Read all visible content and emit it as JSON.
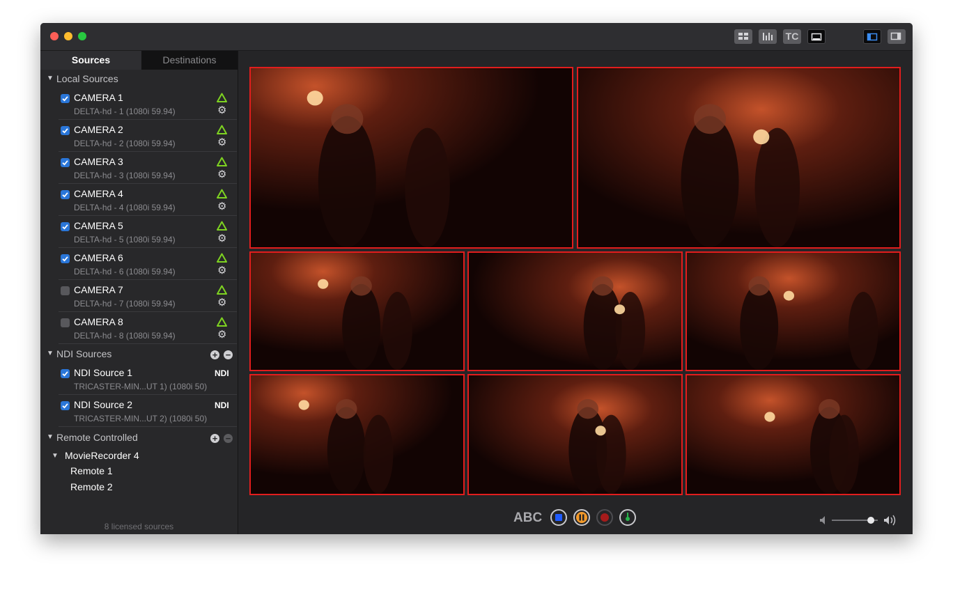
{
  "sidebar": {
    "tabs": [
      "Sources",
      "Destinations"
    ],
    "local_sources_label": "Local Sources",
    "cameras": [
      {
        "name": "CAMERA 1",
        "detail": "DELTA-hd - 1 (1080i 59.94)",
        "checked": true
      },
      {
        "name": "CAMERA 2",
        "detail": "DELTA-hd - 2 (1080i 59.94)",
        "checked": true
      },
      {
        "name": "CAMERA 3",
        "detail": "DELTA-hd - 3 (1080i 59.94)",
        "checked": true
      },
      {
        "name": "CAMERA 4",
        "detail": "DELTA-hd - 4 (1080i 59.94)",
        "checked": true
      },
      {
        "name": "CAMERA 5",
        "detail": "DELTA-hd - 5 (1080i 59.94)",
        "checked": true
      },
      {
        "name": "CAMERA 6",
        "detail": "DELTA-hd - 6 (1080i 59.94)",
        "checked": true
      },
      {
        "name": "CAMERA 7",
        "detail": "DELTA-hd - 7 (1080i 59.94)",
        "checked": false
      },
      {
        "name": "CAMERA 8",
        "detail": "DELTA-hd - 8 (1080i 59.94)",
        "checked": false
      }
    ],
    "ndi_sources_label": "NDI Sources",
    "ndi_sources": [
      {
        "name": "NDI Source 1",
        "detail": "TRICASTER-MIN...UT 1) (1080i 50)",
        "badge": "NDI",
        "checked": true
      },
      {
        "name": "NDI Source 2",
        "detail": "TRICASTER-MIN...UT 2) (1080i 50)",
        "badge": "NDI",
        "checked": true
      }
    ],
    "remote_label": "Remote Controlled",
    "remote_group": "MovieRecorder 4",
    "remote_items": [
      "Remote 1",
      "Remote 2"
    ],
    "footer": "8 licensed sources"
  },
  "toolbar": {
    "buttons": [
      "grid-layout-icon",
      "audio-meters-icon",
      "timecode",
      "monitor-icon"
    ],
    "timecode_label": "TC",
    "panel_buttons": [
      "left-panel-icon",
      "right-panel-icon"
    ]
  },
  "controls": {
    "abc_label": "ABC",
    "buttons": [
      "stop-icon",
      "pause-icon",
      "record-icon",
      "timer-icon"
    ],
    "volume_level": 0.85
  },
  "colors": {
    "tile_border": "#e21d1d",
    "checkbox": "#2a76d8",
    "warning": "#7ed321",
    "stop": "#1f5bff",
    "pause": "#f39a2b",
    "record": "#a51b1b",
    "timer": "#27b24a"
  }
}
